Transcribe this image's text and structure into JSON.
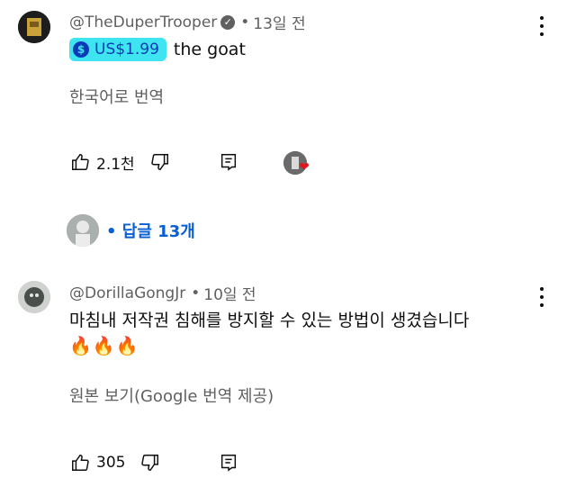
{
  "comments": [
    {
      "author": "@TheDuperTrooper",
      "time": "13일 전",
      "superthanks": "US$1.99",
      "text": "the goat",
      "translate_label": "한국어로 번역",
      "likes": "2.1천",
      "replies_label": "답글 13개"
    },
    {
      "author": "@DorillaGongJr",
      "time": "10일 전",
      "text": "마침내 저작권 침해를 방지할 수 있는 방법이 생겼습니다",
      "emoji": "🔥🔥🔥",
      "translate_label": "원본 보기(Google 번역 제공)",
      "likes": "305"
    }
  ],
  "ui": {
    "dot": "•",
    "coin_symbol": "$",
    "verified_symbol": "✓",
    "heart_symbol": "❤"
  },
  "icons": [
    "like-icon",
    "dislike-icon",
    "reply-icon",
    "more-icon",
    "verified-icon",
    "heart-icon"
  ],
  "colors": {
    "superthanks_bg": "#3ee5f0",
    "superthanks_fg": "#0b3ab8",
    "reply_link": "#065fd4",
    "meta": "#606060",
    "heart": "#e0161d"
  }
}
